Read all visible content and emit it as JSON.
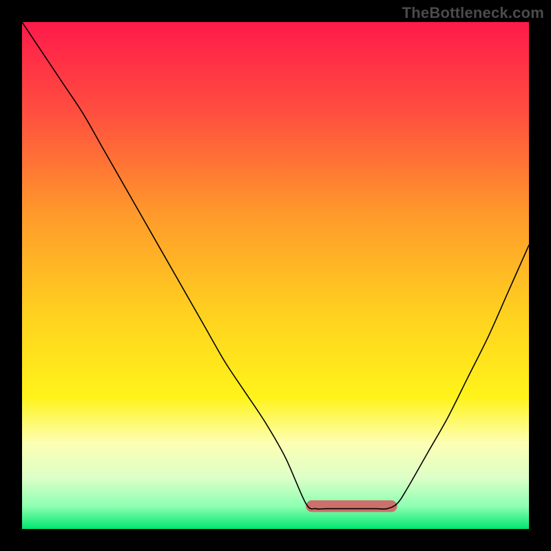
{
  "watermark": "TheBottleneck.com",
  "chart_data": {
    "type": "line",
    "title": "",
    "xlabel": "",
    "ylabel": "",
    "xlim": [
      0,
      100
    ],
    "ylim": [
      0,
      100
    ],
    "grid": false,
    "legend": false,
    "background_gradient": {
      "stops": [
        {
          "offset": 0.0,
          "color": "#ff1a4b"
        },
        {
          "offset": 0.18,
          "color": "#ff4f3f"
        },
        {
          "offset": 0.38,
          "color": "#ff9a2b"
        },
        {
          "offset": 0.58,
          "color": "#ffd21f"
        },
        {
          "offset": 0.74,
          "color": "#fff31a"
        },
        {
          "offset": 0.83,
          "color": "#fdffb3"
        },
        {
          "offset": 0.9,
          "color": "#dcffc8"
        },
        {
          "offset": 0.955,
          "color": "#8dffb2"
        },
        {
          "offset": 1.0,
          "color": "#00e66e"
        }
      ]
    },
    "notch_band": {
      "color": "#cd6f6a",
      "x_start": 56,
      "x_end": 74,
      "y": 4.5,
      "thickness": 2.3
    },
    "series": [
      {
        "name": "curve",
        "color": "#000000",
        "stroke_width": 1.6,
        "x": [
          0,
          4,
          8,
          12,
          16,
          20,
          24,
          28,
          32,
          36,
          40,
          44,
          48,
          52,
          56,
          58,
          60,
          64,
          68,
          70,
          72,
          74,
          76,
          80,
          84,
          88,
          92,
          96,
          100
        ],
        "y": [
          100,
          94,
          88,
          82,
          75,
          68,
          61,
          54,
          47,
          40,
          33,
          27,
          21,
          14,
          5,
          4,
          4,
          4,
          4,
          4,
          4,
          5,
          8,
          15,
          22,
          30,
          38,
          47,
          56
        ]
      }
    ]
  }
}
